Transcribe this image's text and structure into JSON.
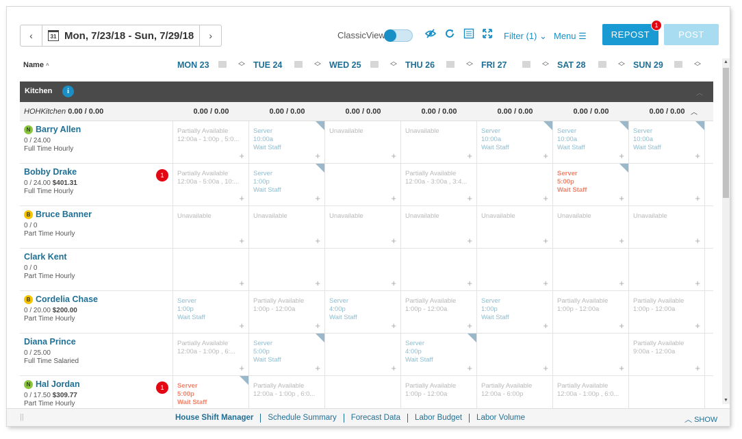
{
  "toolbar": {
    "date_range": "Mon, 7/23/18 - Sun, 7/29/18",
    "calendar_day": "31",
    "prev_icon": "‹",
    "next_icon": "›",
    "classic_view": "ClassicView",
    "filter": "Filter (1)",
    "menu": "Menu",
    "repost": "REPOST",
    "repost_badge": "1",
    "post": "POST"
  },
  "header": {
    "name": "Name",
    "days": [
      "MON 23",
      "TUE 24",
      "WED 25",
      "THU 26",
      "FRI 27",
      "SAT 28",
      "SUN 29"
    ]
  },
  "section": {
    "title": "Kitchen",
    "info": "i",
    "totals_label": "HOHKitchen",
    "totals_value": "0.00 / 0.00",
    "day_totals": [
      "0.00 / 0.00",
      "0.00 / 0.00",
      "0.00 / 0.00",
      "0.00 / 0.00",
      "0.00 / 0.00",
      "0.00 / 0.00",
      "0.00 / 0.00"
    ]
  },
  "employees": [
    {
      "name": "Barry Allen",
      "tag": "N",
      "hours": "0 / 24.00",
      "amount": "",
      "type": "Full Time Hourly",
      "alert": "",
      "cells": [
        {
          "s": "u",
          "l1": "Partially Available",
          "l2": "12:00a - 1:00p , 5:0...",
          "l3": "",
          "corner": false
        },
        {
          "s": "srv",
          "l1": "Server",
          "l2": "10:00a",
          "l3": "Wait Staff",
          "corner": true
        },
        {
          "s": "u",
          "l1": "Unavailable",
          "l2": "",
          "l3": "",
          "corner": false
        },
        {
          "s": "u",
          "l1": "Unavailable",
          "l2": "",
          "l3": "",
          "corner": false
        },
        {
          "s": "srv",
          "l1": "Server",
          "l2": "10:00a",
          "l3": "Wait Staff",
          "corner": true
        },
        {
          "s": "srv",
          "l1": "Server",
          "l2": "10:00a",
          "l3": "Wait Staff",
          "corner": true
        },
        {
          "s": "srv",
          "l1": "Server",
          "l2": "10:00a",
          "l3": "Wait Staff",
          "corner": true
        }
      ]
    },
    {
      "name": "Bobby Drake",
      "tag": "",
      "hours": "0 / 24.00",
      "amount": "$401.31",
      "type": "Full Time Hourly",
      "alert": "1",
      "cells": [
        {
          "s": "u",
          "l1": "Partially Available",
          "l2": "12:00a - 5:00a , 10:...",
          "l3": "",
          "corner": false
        },
        {
          "s": "srv",
          "l1": "Server",
          "l2": "1:00p",
          "l3": "Wait Staff",
          "corner": true
        },
        {
          "s": "u",
          "l1": "",
          "l2": "",
          "l3": "",
          "corner": false
        },
        {
          "s": "u",
          "l1": "Partially Available",
          "l2": "12:00a - 3:00a , 3:4...",
          "l3": "",
          "corner": false
        },
        {
          "s": "u",
          "l1": "",
          "l2": "",
          "l3": "",
          "corner": false
        },
        {
          "s": "red",
          "l1": "Server",
          "l2": "5:00p",
          "l3": "Wait Staff",
          "corner": true
        },
        {
          "s": "u",
          "l1": "",
          "l2": "",
          "l3": "",
          "corner": false
        }
      ]
    },
    {
      "name": "Bruce Banner",
      "tag": "B",
      "hours": "0 / 0",
      "amount": "",
      "type": "Part Time Hourly",
      "alert": "",
      "cells": [
        {
          "s": "u",
          "l1": "Unavailable",
          "l2": "",
          "l3": "",
          "corner": false
        },
        {
          "s": "u",
          "l1": "Unavailable",
          "l2": "",
          "l3": "",
          "corner": false
        },
        {
          "s": "u",
          "l1": "Unavailable",
          "l2": "",
          "l3": "",
          "corner": false
        },
        {
          "s": "u",
          "l1": "Unavailable",
          "l2": "",
          "l3": "",
          "corner": false
        },
        {
          "s": "u",
          "l1": "Unavailable",
          "l2": "",
          "l3": "",
          "corner": false
        },
        {
          "s": "u",
          "l1": "Unavailable",
          "l2": "",
          "l3": "",
          "corner": false
        },
        {
          "s": "u",
          "l1": "Unavailable",
          "l2": "",
          "l3": "",
          "corner": false
        }
      ]
    },
    {
      "name": "Clark Kent",
      "tag": "",
      "hours": "0 / 0",
      "amount": "",
      "type": "Part Time Hourly",
      "alert": "",
      "cells": [
        {
          "s": "u",
          "l1": "",
          "l2": "",
          "l3": "",
          "corner": false
        },
        {
          "s": "u",
          "l1": "",
          "l2": "",
          "l3": "",
          "corner": false
        },
        {
          "s": "u",
          "l1": "",
          "l2": "",
          "l3": "",
          "corner": false
        },
        {
          "s": "u",
          "l1": "",
          "l2": "",
          "l3": "",
          "corner": false
        },
        {
          "s": "u",
          "l1": "",
          "l2": "",
          "l3": "",
          "corner": false
        },
        {
          "s": "u",
          "l1": "",
          "l2": "",
          "l3": "",
          "corner": false
        },
        {
          "s": "u",
          "l1": "",
          "l2": "",
          "l3": "",
          "corner": false
        }
      ]
    },
    {
      "name": "Cordelia Chase",
      "tag": "B",
      "hours": "0 / 20.00",
      "amount": "$200.00",
      "type": "Part Time Hourly",
      "alert": "",
      "cells": [
        {
          "s": "srv",
          "l1": "Server",
          "l2": "1:00p",
          "l3": "Wait Staff",
          "corner": false
        },
        {
          "s": "u",
          "l1": "Partially Available",
          "l2": "1:00p - 12:00a",
          "l3": "",
          "corner": false
        },
        {
          "s": "srv",
          "l1": "Server",
          "l2": "4:00p",
          "l3": "Wait Staff",
          "corner": false
        },
        {
          "s": "u",
          "l1": "Partially Available",
          "l2": "1:00p - 12:00a",
          "l3": "",
          "corner": false
        },
        {
          "s": "srv",
          "l1": "Server",
          "l2": "1:00p",
          "l3": "Wait Staff",
          "corner": false
        },
        {
          "s": "u",
          "l1": "Partially Available",
          "l2": "1:00p - 12:00a",
          "l3": "",
          "corner": false
        },
        {
          "s": "u",
          "l1": "Partially Available",
          "l2": "1:00p - 12:00a",
          "l3": "",
          "corner": false
        }
      ]
    },
    {
      "name": "Diana Prince",
      "tag": "",
      "hours": "0 / 25.00",
      "amount": "",
      "type": "Full Time Salaried",
      "alert": "",
      "cells": [
        {
          "s": "u",
          "l1": "Partially Available",
          "l2": "12:00a - 1:00p , 6:...",
          "l3": "",
          "corner": false
        },
        {
          "s": "srv",
          "l1": "Server",
          "l2": "5:00p",
          "l3": "Wait Staff",
          "corner": true
        },
        {
          "s": "u",
          "l1": "",
          "l2": "",
          "l3": "",
          "corner": false
        },
        {
          "s": "srv",
          "l1": "Server",
          "l2": "4:00p",
          "l3": "Wait Staff",
          "corner": true
        },
        {
          "s": "u",
          "l1": "",
          "l2": "",
          "l3": "",
          "corner": false
        },
        {
          "s": "u",
          "l1": "",
          "l2": "",
          "l3": "",
          "corner": false
        },
        {
          "s": "u",
          "l1": "Partially Available",
          "l2": "9:00a - 12:00a",
          "l3": "",
          "corner": false
        }
      ]
    },
    {
      "name": "Hal Jordan",
      "tag": "N",
      "hours": "0 / 17.50",
      "amount": "$309.77",
      "type": "Part Time Hourly",
      "alert": "1",
      "cells": [
        {
          "s": "red",
          "l1": "Server",
          "l2": "5:00p",
          "l3": "Wait Staff",
          "corner": true
        },
        {
          "s": "u",
          "l1": "Partially Available",
          "l2": "12:00a - 1:00p , 6:0...",
          "l3": "",
          "corner": false
        },
        {
          "s": "u",
          "l1": "",
          "l2": "",
          "l3": "",
          "corner": false
        },
        {
          "s": "u",
          "l1": "Partially Available",
          "l2": "1:00p - 12:00a",
          "l3": "",
          "corner": false
        },
        {
          "s": "u",
          "l1": "Partially Available",
          "l2": "12:00a - 6:00p",
          "l3": "",
          "corner": false
        },
        {
          "s": "u",
          "l1": "Partially Available",
          "l2": "12:00a - 1:00p , 6:0...",
          "l3": "",
          "corner": false
        },
        {
          "s": "u",
          "l1": "",
          "l2": "",
          "l3": "",
          "corner": false
        }
      ]
    }
  ],
  "footer": {
    "tabs": [
      "House Shift Manager",
      "Schedule Summary",
      "Forecast Data",
      "Labor Budget",
      "Labor Volume"
    ],
    "show": "SHOW"
  }
}
